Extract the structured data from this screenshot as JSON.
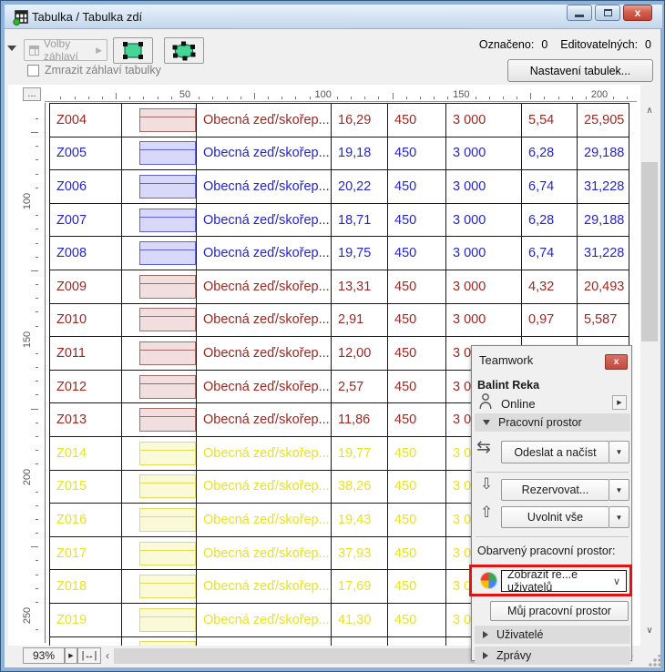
{
  "window": {
    "title": "Tabulka /  Tabulka zdí",
    "controls": {
      "minimize": "—",
      "maximize": "❐",
      "close": "x"
    }
  },
  "toolbar": {
    "header_options": "Volby záhlaví",
    "freeze_header": "Zmrazit záhlaví tabulky",
    "selected_label": "Označeno:",
    "selected_value": "0",
    "editable_label": "Editovatelných:",
    "editable_value": "0",
    "settings": "Nastavení tabulek..."
  },
  "ruler": {
    "corner": "...",
    "h_labels": [
      "50",
      "100",
      "150",
      "200"
    ],
    "v_labels": [
      "100",
      "150",
      "200",
      "250"
    ]
  },
  "table": {
    "rows": [
      {
        "id": "Z004",
        "color": "red",
        "name": "Obecná zeď/skořep...",
        "values": [
          "16,29",
          "450",
          "3 000",
          "5,54",
          "25,905"
        ]
      },
      {
        "id": "Z005",
        "color": "blue",
        "name": "Obecná zeď/skořep...",
        "values": [
          "19,18",
          "450",
          "3 000",
          "6,28",
          "29,188"
        ]
      },
      {
        "id": "Z006",
        "color": "blue",
        "name": "Obecná zeď/skořep...",
        "values": [
          "20,22",
          "450",
          "3 000",
          "6,74",
          "31,228"
        ]
      },
      {
        "id": "Z007",
        "color": "blue",
        "name": "Obecná zeď/skořep...",
        "values": [
          "18,71",
          "450",
          "3 000",
          "6,28",
          "29,188"
        ]
      },
      {
        "id": "Z008",
        "color": "blue",
        "name": "Obecná zeď/skořep...",
        "values": [
          "19,75",
          "450",
          "3 000",
          "6,74",
          "31,228"
        ]
      },
      {
        "id": "Z009",
        "color": "red",
        "name": "Obecná zeď/skořep...",
        "values": [
          "13,31",
          "450",
          "3 000",
          "4,32",
          "20,493"
        ]
      },
      {
        "id": "Z010",
        "color": "red",
        "name": "Obecná zeď/skořep...",
        "values": [
          "2,91",
          "450",
          "3 000",
          "0,97",
          "5,587"
        ]
      },
      {
        "id": "Z011",
        "color": "red",
        "name": "Obecná zeď/skořep...",
        "values": [
          "12,00",
          "450",
          "3 000",
          "",
          ""
        ]
      },
      {
        "id": "Z012",
        "color": "red",
        "name": "Obecná zeď/skořep...",
        "values": [
          "2,57",
          "450",
          "3 000",
          "",
          ""
        ]
      },
      {
        "id": "Z013",
        "color": "red",
        "name": "Obecná zeď/skořep...",
        "values": [
          "11,86",
          "450",
          "3 000",
          "",
          ""
        ]
      },
      {
        "id": "Z014",
        "color": "yellow",
        "name": "Obecná zeď/skořep...",
        "values": [
          "19,77",
          "450",
          "3 000",
          "",
          ""
        ]
      },
      {
        "id": "Z015",
        "color": "yellow",
        "name": "Obecná zeď/skořep...",
        "values": [
          "38,26",
          "450",
          "3 000",
          "",
          ""
        ]
      },
      {
        "id": "Z016",
        "color": "yellow",
        "name": "Obecná zeď/skořep...",
        "values": [
          "19,43",
          "450",
          "3 000",
          "",
          ""
        ]
      },
      {
        "id": "Z017",
        "color": "yellow",
        "name": "Obecná zeď/skořep...",
        "values": [
          "37,93",
          "450",
          "3 000",
          "",
          ""
        ]
      },
      {
        "id": "Z018",
        "color": "yellow",
        "name": "Obecná zeď/skořep...",
        "values": [
          "17,69",
          "450",
          "3 000",
          "",
          ""
        ]
      },
      {
        "id": "Z019",
        "color": "yellow",
        "name": "Obecná zeď/skořep...",
        "values": [
          "41,30",
          "450",
          "3 000",
          "",
          ""
        ]
      }
    ],
    "partial_row": {
      "color": "yellow"
    }
  },
  "colors": {
    "row_red": "#9e2720",
    "row_blue": "#2424d2",
    "row_yellow": "#e9e322",
    "swatch_red_fill": "#f1dede",
    "swatch_red_border": "#a56a66",
    "swatch_blue_fill": "#d8d8f8",
    "swatch_blue_border": "#6161e0",
    "swatch_yellow_fill": "#fbfad8",
    "swatch_yellow_border": "#e2dc5a",
    "callout": "#e11414",
    "marquee_green": "#45d696"
  },
  "teamwork": {
    "title": "Teamwork",
    "user_name": "Balint Reka",
    "status": "Online",
    "workspace_section": "Pracovní prostor",
    "send_receive": "Odeslat a načíst",
    "reserve": "Rezervovat...",
    "release_all": "Uvolnit vše",
    "colored_workspace_label": "Obarvený pracovní prostor:",
    "colored_dropdown_value": "Zobrazit re...e uživatelů",
    "my_workspace": "Můj pracovní prostor",
    "users_section": "Uživatelé",
    "messages_section": "Zprávy",
    "close_glyph": "x"
  },
  "statusbar": {
    "zoom": "93%"
  },
  "icons": {
    "scroll_up": "∧",
    "scroll_down": "∨",
    "scroll_left": "‹",
    "scroll_right": "›",
    "dropdown": "▼",
    "flyout_right": "▶",
    "send_receive": "⇆",
    "reserve": "⇩",
    "release": "⇧",
    "select_chevron": "∨",
    "fit_width": "↔",
    "spin_right": "▶"
  }
}
